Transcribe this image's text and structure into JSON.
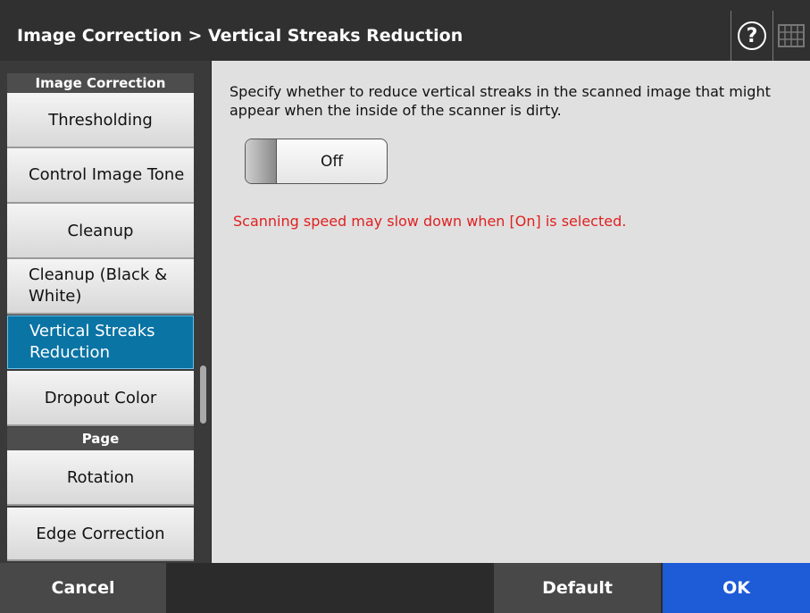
{
  "header": {
    "title": "Image Correction > Vertical Streaks Reduction",
    "help_glyph": "?"
  },
  "sidebar": {
    "sections": [
      {
        "heading": "Image Correction",
        "items": [
          "Thresholding",
          "Control Image Tone",
          "Cleanup",
          "Cleanup (Black & White)",
          "Vertical Streaks Reduction",
          "Dropout Color"
        ]
      },
      {
        "heading": "Page",
        "items": [
          "Rotation",
          "Edge Correction"
        ]
      }
    ],
    "selected": "Vertical Streaks Reduction"
  },
  "main": {
    "description": "Specify whether to reduce vertical streaks in the scanned image that might appear when the inside of the scanner is dirty.",
    "toggle_state": "Off",
    "warning": "Scanning speed may slow down when [On] is selected."
  },
  "footer": {
    "cancel": "Cancel",
    "default": "Default",
    "ok": "OK"
  },
  "colors": {
    "accent": "#0a74a4",
    "ok_button": "#1e5bd6",
    "warning": "#e12020"
  },
  "icons": {
    "help": "question-mark-circle-icon",
    "keyboard": "keyboard-icon"
  }
}
